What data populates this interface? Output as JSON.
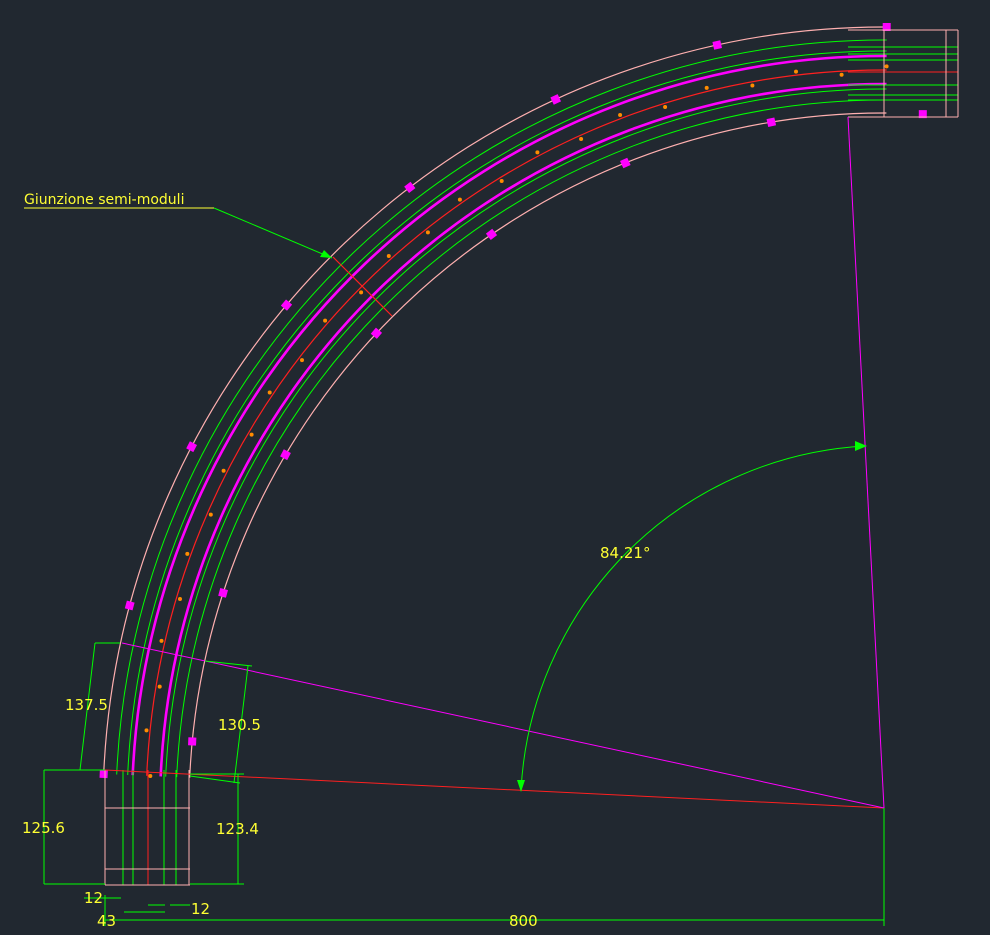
{
  "drawing": {
    "callout_label": "Giunzione semi-moduli",
    "angle_label": "84.21°",
    "dimensions": {
      "bottom_left_height": "125.6",
      "bottom_right_height": "123.4",
      "segment_left_height": "137.5",
      "segment_right_height": "130.5",
      "left_offset": "12",
      "right_offset": "12",
      "inner_width": "43",
      "span": "800"
    }
  },
  "colors": {
    "background": "#212830",
    "outline": "#ffb0b0",
    "green": "#00ff00",
    "magenta": "#ff00ff",
    "centerline": "#ff2020",
    "dot": "#ff8c00",
    "text": "#ffff33"
  }
}
